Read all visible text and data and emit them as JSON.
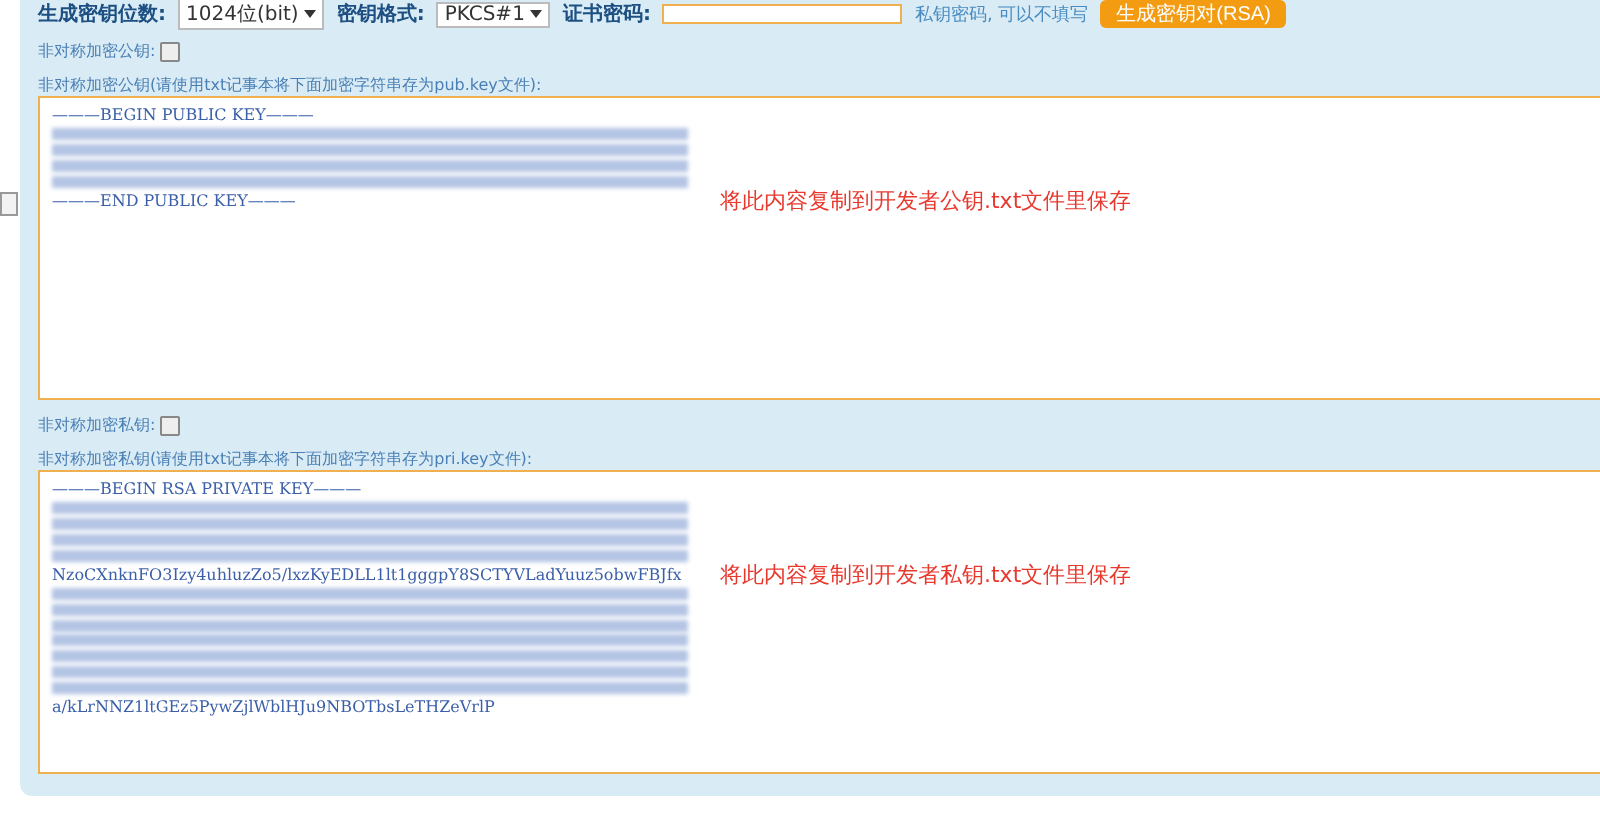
{
  "options_row": {
    "bits_label": "生成密钥位数:",
    "bits_value": "1024位(bit)",
    "format_label": "密钥格式:",
    "format_value": "PKCS#1",
    "password_label": "证书密码:",
    "password_hint": "私钥密码, 可以不填写",
    "generate_button": "生成密钥对(RSA)"
  },
  "sections": [
    {
      "title": "非对称加密公钥:",
      "description": "非对称加密公钥(请使用txt记事本将下面加密字符串存为pub.key文件):",
      "note": "将此内容复制到开发者公钥.txt文件里保存",
      "lines": [
        {
          "kind": "text",
          "text": "———BEGIN PUBLIC KEY———"
        },
        {
          "kind": "redacted"
        },
        {
          "kind": "redacted"
        },
        {
          "kind": "redacted"
        },
        {
          "kind": "redacted"
        },
        {
          "kind": "text",
          "text": "———END PUBLIC KEY———"
        }
      ]
    },
    {
      "title": "非对称加密私钥:",
      "description": "非对称加密私钥(请使用txt记事本将下面加密字符串存为pri.key文件):",
      "note": "将此内容复制到开发者私钥.txt文件里保存",
      "lines": [
        {
          "kind": "text",
          "text": "———BEGIN RSA PRIVATE KEY———"
        },
        {
          "kind": "redacted"
        },
        {
          "kind": "redacted"
        },
        {
          "kind": "redacted"
        },
        {
          "kind": "redacted"
        },
        {
          "kind": "text",
          "text": "NzoCXnknFO3Izy4uhluzZo5/lxzKyEDLL1lt1gggpY8SCTYVLadYuuz5obwFBJfx"
        },
        {
          "kind": "redacted"
        },
        {
          "kind": "redacted"
        },
        {
          "kind": "redacted"
        },
        {
          "kind": "redacted"
        },
        {
          "kind": "redacted"
        },
        {
          "kind": "redacted"
        },
        {
          "kind": "redacted"
        },
        {
          "kind": "text",
          "text": "a/kLrNNZ1ltGEz5PywZjlWblHJu9NBOTbsLeTHZeVrlP"
        }
      ]
    }
  ]
}
